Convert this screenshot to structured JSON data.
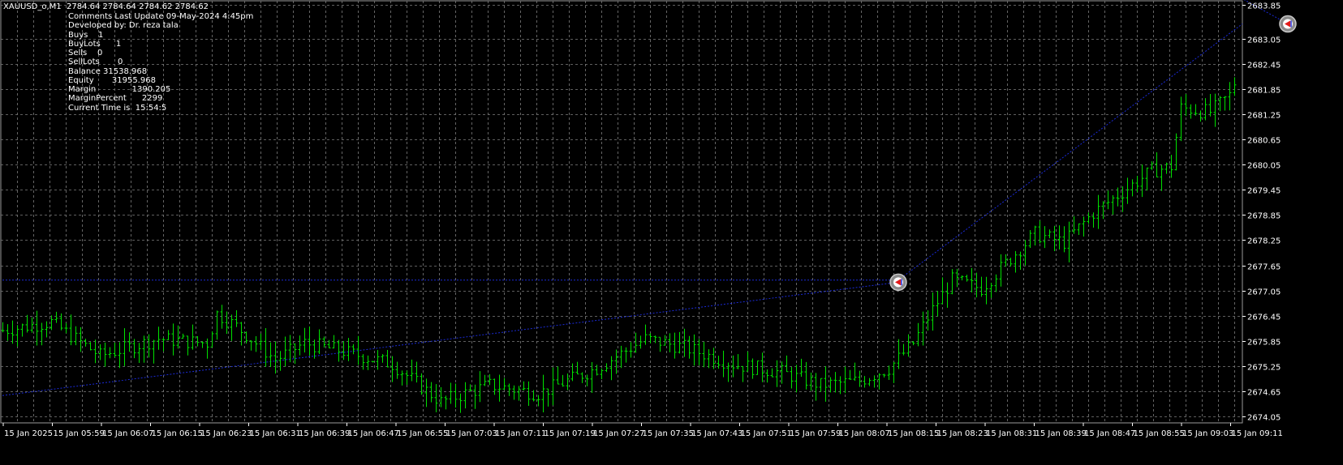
{
  "window": {
    "symbol_header": "XAUUSD_o,M1  2784.64 2784.64 2784.62 2784.62"
  },
  "comment_lines": [
    "Comments Last Update 09-May-2024 4:45pm",
    "Developed by: Dr. reza tala",
    "Buys    1",
    "BuyLots      1",
    "Sells    0",
    "SellLots       0",
    "Balance 31538.968",
    "Equity       31955.968",
    "Margin              1390.205",
    "MarginPercent      2299",
    "Current Time is  15:54:5"
  ],
  "colors": {
    "background": "#000000",
    "grid": "#7d7d7d",
    "candle": "#00e000",
    "trade_line": "#1a2ad6",
    "axis_text": "#ffffff"
  },
  "icons": [
    "trade-arrow-icon"
  ],
  "chart_data": {
    "type": "ohlc",
    "title": "",
    "grid": true,
    "y_axis_side": "right",
    "ylim": [
      2673.9,
      2683.95
    ],
    "y_ticks": [
      "2683.85",
      "2683.05",
      "2682.45",
      "2681.85",
      "2681.25",
      "2680.65",
      "2680.05",
      "2679.45",
      "2678.85",
      "2678.25",
      "2677.65",
      "2677.05",
      "2676.45",
      "2675.85",
      "2675.25",
      "2674.65",
      "2674.05"
    ],
    "x_ticks": [
      "15 Jan 2025",
      "15 Jan 05:59",
      "15 Jan 06:07",
      "15 Jan 06:15",
      "15 Jan 06:23",
      "15 Jan 06:31",
      "15 Jan 06:39",
      "15 Jan 06:47",
      "15 Jan 06:55",
      "15 Jan 07:03",
      "15 Jan 07:11",
      "15 Jan 07:19",
      "15 Jan 07:27",
      "15 Jan 07:35",
      "15 Jan 07:43",
      "15 Jan 07:51",
      "15 Jan 07:59",
      "15 Jan 08:07",
      "15 Jan 08:15",
      "15 Jan 08:23",
      "15 Jan 08:31",
      "15 Jan 08:39",
      "15 Jan 08:47",
      "15 Jan 08:55",
      "15 Jan 09:03",
      "15 Jan 09:11"
    ],
    "bar_count": 256,
    "close_path": [
      [
        0,
        2676.1
      ],
      [
        10,
        2676.3
      ],
      [
        20,
        2675.5
      ],
      [
        32,
        2675.9
      ],
      [
        42,
        2675.8
      ],
      [
        44,
        2676.5
      ],
      [
        48,
        2676.2
      ],
      [
        56,
        2675.4
      ],
      [
        62,
        2675.8
      ],
      [
        70,
        2675.6
      ],
      [
        80,
        2675.3
      ],
      [
        90,
        2674.4
      ],
      [
        100,
        2674.8
      ],
      [
        110,
        2674.6
      ],
      [
        122,
        2675.2
      ],
      [
        132,
        2675.9
      ],
      [
        140,
        2675.7
      ],
      [
        150,
        2675.3
      ],
      [
        160,
        2675.1
      ],
      [
        168,
        2674.8
      ],
      [
        176,
        2674.9
      ],
      [
        182,
        2675.2
      ],
      [
        187,
        2675.8
      ],
      [
        191,
        2676.6
      ],
      [
        195,
        2677.3
      ],
      [
        201,
        2677.1
      ],
      [
        206,
        2677.7
      ],
      [
        212,
        2678.4
      ],
      [
        218,
        2678.2
      ],
      [
        224,
        2678.9
      ],
      [
        230,
        2679.4
      ],
      [
        236,
        2679.9
      ],
      [
        240,
        2680.0
      ],
      [
        242,
        2681.4
      ],
      [
        248,
        2681.3
      ],
      [
        252,
        2681.7
      ],
      [
        256,
        2682.9
      ],
      [
        260,
        2681.9
      ],
      [
        268,
        2681.6
      ],
      [
        278,
        2681.9
      ],
      [
        286,
        2682.7
      ],
      [
        290,
        2682.2
      ],
      [
        294,
        2681.5
      ],
      [
        302,
        2681.2
      ],
      [
        312,
        2681.3
      ],
      [
        320,
        2681.1
      ],
      [
        328,
        2681.0
      ]
    ],
    "trade_markers": [
      {
        "type": "buy",
        "bar": 184,
        "price": 2677.25
      },
      {
        "type": "buy",
        "bar": 264,
        "price": 2683.4
      }
    ],
    "trade_lines": [
      {
        "from_bar": 0,
        "from_price": 2674.55,
        "to_bar": 184,
        "to_price": 2677.25
      },
      {
        "from_bar": 0,
        "from_price": 2677.3,
        "to_bar": 184,
        "to_price": 2677.3
      },
      {
        "from_bar": 184,
        "from_price": 2677.3,
        "to_bar": 264,
        "to_price": 2683.4
      },
      {
        "from_bar": 264,
        "from_price": 2683.4,
        "to_bar": 330,
        "to_price": 2684.0
      }
    ]
  }
}
